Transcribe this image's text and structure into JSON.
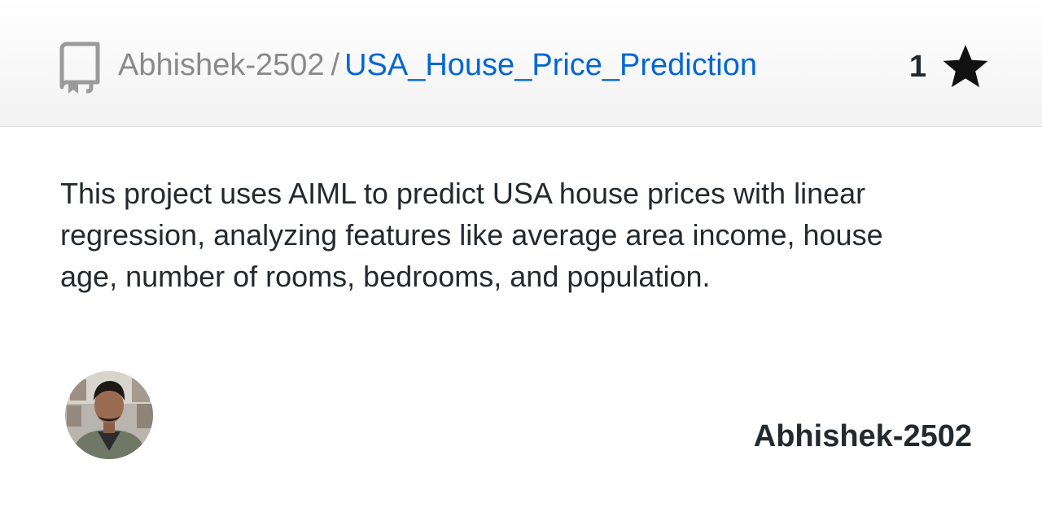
{
  "header": {
    "owner": "Abhishek-2502",
    "separator": "/",
    "repo_name": "USA_House_Price_Prediction",
    "star_count": "1",
    "icons": {
      "repo": "repo-book-icon",
      "star": "star-icon"
    }
  },
  "description": "This project uses AIML to predict USA house prices with linear regression, analyzing features like average area income, house age, number of rooms, bedrooms, and population.",
  "author": {
    "name": "Abhishek-2502",
    "avatar": "avatar-photo"
  },
  "colors": {
    "link": "#0366d6",
    "muted": "#8a8a8a",
    "text": "#24292e"
  }
}
